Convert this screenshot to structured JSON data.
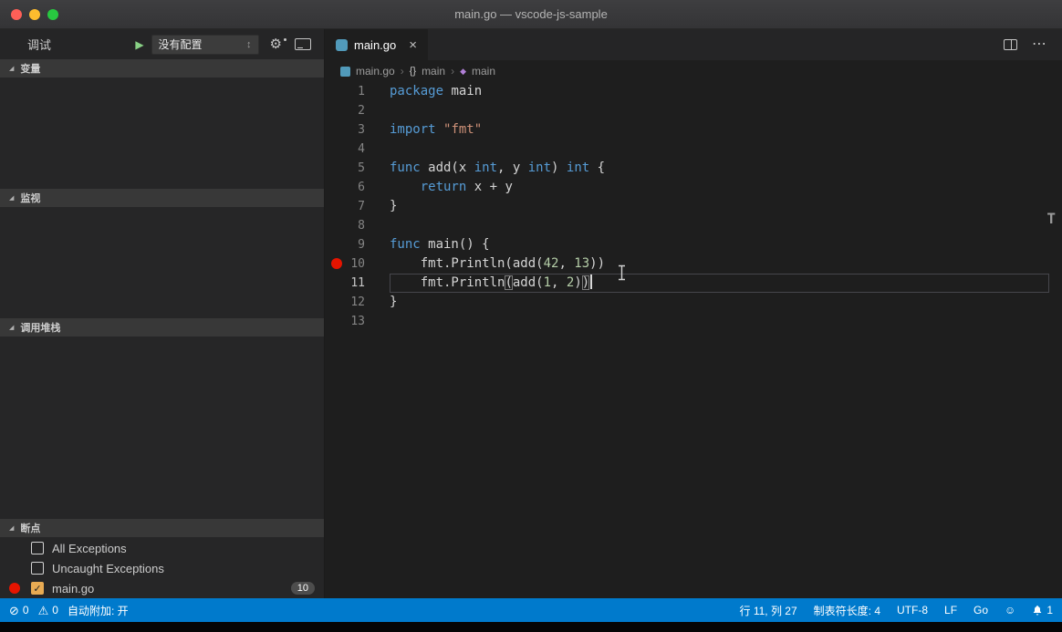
{
  "colors": {
    "accent": "#007acc",
    "keyword": "#569cd6",
    "string": "#ce9178",
    "number": "#b5cea8",
    "text": "#d4d4d4",
    "breakpoint": "#e51400",
    "checkbox_checked": "#e8ab53"
  },
  "window": {
    "title": "main.go — vscode-js-sample"
  },
  "sidebar": {
    "debug_label": "调试",
    "config_dropdown": "没有配置",
    "sections": [
      {
        "label": "变量"
      },
      {
        "label": "监视"
      },
      {
        "label": "调用堆栈"
      },
      {
        "label": "断点"
      }
    ],
    "breakpoints": [
      {
        "label": "All Exceptions",
        "checked": false,
        "dot": false
      },
      {
        "label": "Uncaught Exceptions",
        "checked": false,
        "dot": false
      },
      {
        "label": "main.go",
        "checked": true,
        "dot": true,
        "badge": "10"
      }
    ]
  },
  "editor": {
    "tab": {
      "label": "main.go",
      "close": "×"
    },
    "breadcrumb": [
      {
        "label": "main.go"
      },
      {
        "label": "main"
      },
      {
        "label": "main"
      }
    ],
    "lines": [
      {
        "n": "1",
        "tokens": [
          {
            "t": "package",
            "c": "kw"
          },
          {
            "t": " main",
            "c": "pl"
          }
        ]
      },
      {
        "n": "2",
        "tokens": []
      },
      {
        "n": "3",
        "tokens": [
          {
            "t": "import",
            "c": "kw"
          },
          {
            "t": " ",
            "c": "pl"
          },
          {
            "t": "\"fmt\"",
            "c": "str"
          }
        ]
      },
      {
        "n": "4",
        "tokens": []
      },
      {
        "n": "5",
        "tokens": [
          {
            "t": "func",
            "c": "kw"
          },
          {
            "t": " add(x ",
            "c": "pl"
          },
          {
            "t": "int",
            "c": "kw"
          },
          {
            "t": ", y ",
            "c": "pl"
          },
          {
            "t": "int",
            "c": "kw"
          },
          {
            "t": ") ",
            "c": "pl"
          },
          {
            "t": "int",
            "c": "kw"
          },
          {
            "t": " {",
            "c": "pl"
          }
        ]
      },
      {
        "n": "6",
        "tokens": [
          {
            "t": "    ",
            "c": "pl"
          },
          {
            "t": "return",
            "c": "kw"
          },
          {
            "t": " x + y",
            "c": "pl"
          }
        ]
      },
      {
        "n": "7",
        "tokens": [
          {
            "t": "}",
            "c": "pl"
          }
        ]
      },
      {
        "n": "8",
        "tokens": []
      },
      {
        "n": "9",
        "tokens": [
          {
            "t": "func",
            "c": "kw"
          },
          {
            "t": " main() {",
            "c": "pl"
          }
        ]
      },
      {
        "n": "10",
        "breakpoint": true,
        "tokens": [
          {
            "t": "    fmt.Println(add(",
            "c": "pl"
          },
          {
            "t": "42",
            "c": "num"
          },
          {
            "t": ", ",
            "c": "pl"
          },
          {
            "t": "13",
            "c": "num"
          },
          {
            "t": "))",
            "c": "pl"
          }
        ]
      },
      {
        "n": "11",
        "current": true,
        "cursor": true,
        "tokens": [
          {
            "t": "    fmt.Println",
            "c": "pl"
          },
          {
            "t": "(",
            "c": "br"
          },
          {
            "t": "add(",
            "c": "pl"
          },
          {
            "t": "1",
            "c": "num"
          },
          {
            "t": ", ",
            "c": "pl"
          },
          {
            "t": "2",
            "c": "num"
          },
          {
            "t": ")",
            "c": "pl"
          },
          {
            "t": ")",
            "c": "br"
          }
        ]
      },
      {
        "n": "12",
        "tokens": [
          {
            "t": "}",
            "c": "pl"
          }
        ]
      },
      {
        "n": "13",
        "tokens": []
      }
    ]
  },
  "status_bar": {
    "errors": "0",
    "warnings": "0",
    "auto_attach": "自动附加: 开",
    "cursor_position": "行 11, 列 27",
    "tab_size": "制表符长度: 4",
    "encoding": "UTF-8",
    "eol": "LF",
    "language": "Go",
    "bell_count": "1"
  }
}
